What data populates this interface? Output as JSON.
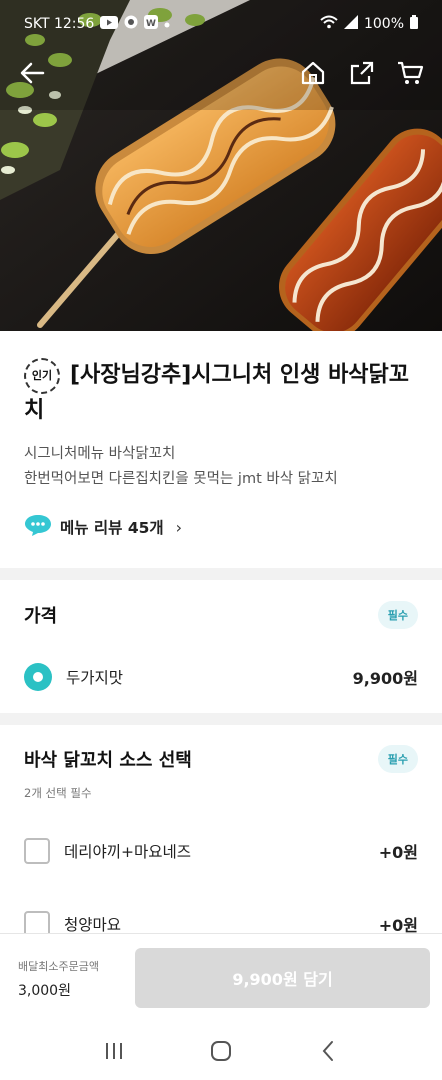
{
  "status_bar": {
    "carrier_time": "SKT 12:56",
    "battery": "100%"
  },
  "nav": {
    "back_icon": "back-arrow-icon",
    "home_icon": "home-icon",
    "share_icon": "share-icon",
    "cart_icon": "cart-icon"
  },
  "product": {
    "popular_badge": "인기",
    "title": "[사장님강추]시그니처 인생 바삭닭꼬치",
    "description_line1": "시그니처메뉴 바삭닭꼬치",
    "description_line2": "한번먹어보면 다른집치킨을 못먹는 jmt 바삭 닭꼬치",
    "review_link": "메뉴 리뷰 45개",
    "review_chevron": "›"
  },
  "price_section": {
    "title": "가격",
    "required": "필수",
    "options": [
      {
        "label": "두가지맛",
        "price": "9,900원",
        "selected": true
      }
    ]
  },
  "sauce_section": {
    "title": "바삭 닭꼬치 소스 선택",
    "required": "필수",
    "subtitle": "2개 선택 필수",
    "options": [
      {
        "label": "데리야끼+마요네즈",
        "price": "+0원",
        "checked": false
      },
      {
        "label": "청양마요",
        "price": "+0원",
        "checked": false
      }
    ]
  },
  "bottom": {
    "min_order_label": "배달최소주문금액",
    "min_order_value": "3,000원",
    "order_button": "9,900원 담기"
  },
  "colors": {
    "accent": "#2bc1c4",
    "required_bg": "#e8f6f8",
    "required_text": "#2a9fb0",
    "disabled_button": "#d9d9d9"
  }
}
